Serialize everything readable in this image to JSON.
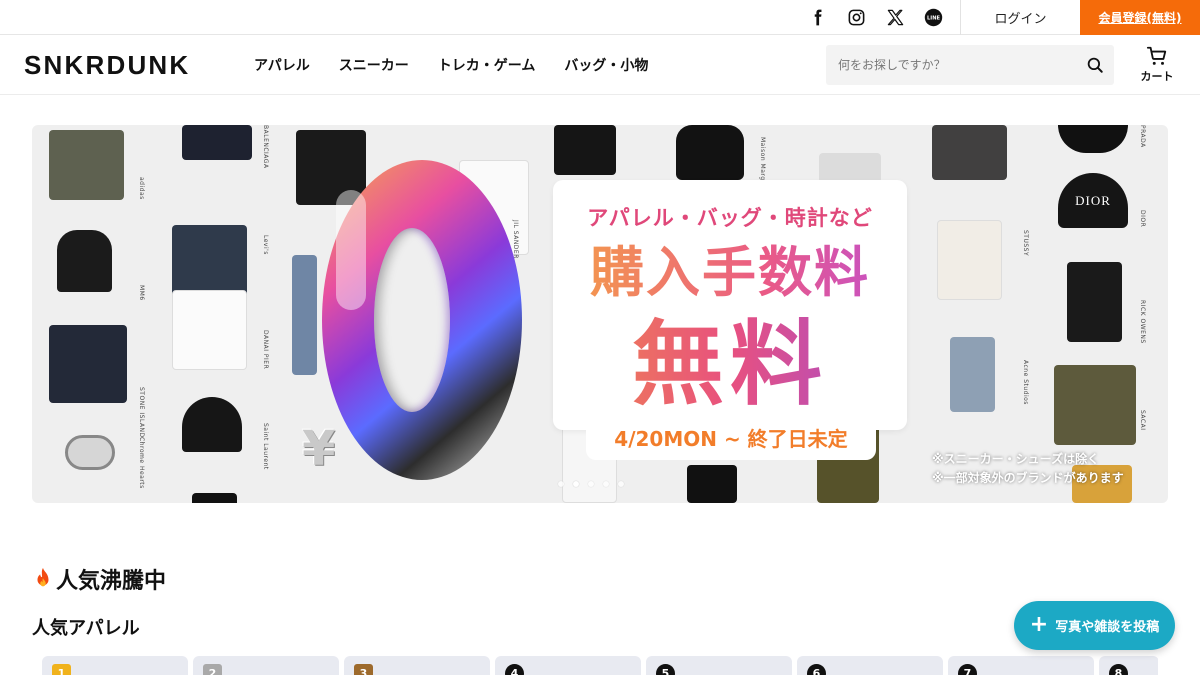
{
  "topbar": {
    "social_icons": [
      "facebook-icon",
      "instagram-icon",
      "x-icon",
      "line-icon"
    ],
    "line_icon_text": "LINE",
    "login_label": "ログイン",
    "register_label": "会員登録(無料)",
    "register_color": "#f56b0a"
  },
  "header": {
    "logo_text": "SNKRDUNK",
    "nav": [
      {
        "label": "アパレル"
      },
      {
        "label": "スニーカー"
      },
      {
        "label": "トレカ・ゲーム"
      },
      {
        "label": "バッグ・小物"
      }
    ],
    "search_placeholder": "何をお探しですか？",
    "cart_label": "カート"
  },
  "banner": {
    "promo_line1": "アパレル・バッグ・時計など",
    "promo_line2": "購入手数料",
    "promo_line3": "無料",
    "promo_date": "4/20MON ~ 終了日未定",
    "promo_note_1": "※スニーカー・シューズは除く",
    "promo_note_2": "※一部対象外のブランドがあります",
    "zero_glyph": "0",
    "yen_glyph": "¥",
    "brand_labels": [
      "adidas",
      "BALENCIAGA",
      "Levi's",
      "MM6",
      "DANAI PIER",
      "STONE ISLAND",
      "Saint Laurent",
      "Chrome Hearts",
      "JIL SANDER",
      "Maison Margiela",
      "PRADA",
      "DIOR",
      "RICK OWENS",
      "Acne Studios",
      "SACAI",
      "STUSSY"
    ],
    "cap_text": "DIOR",
    "carousel_slide_count": 5,
    "carousel_active_index": 1
  },
  "trending": {
    "title": "人気沸騰中",
    "subtitle": "人気アパレル",
    "rank_badges": [
      {
        "label": "1",
        "color": "#f0b21c"
      },
      {
        "label": "2",
        "color": "#a9a9a9"
      },
      {
        "label": "3",
        "color": "#9d6a2c"
      },
      {
        "label": "4",
        "color": "#111111"
      },
      {
        "label": "5",
        "color": "#111111"
      },
      {
        "label": "6",
        "color": "#111111"
      },
      {
        "label": "7",
        "color": "#111111"
      },
      {
        "label": "8",
        "color": "#111111"
      }
    ]
  },
  "fab": {
    "label": "写真や雑談を投稿",
    "plus": "+",
    "color": "#1ca9c5"
  }
}
